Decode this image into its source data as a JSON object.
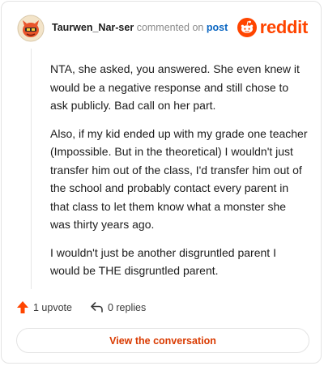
{
  "header": {
    "username": "Taurwen_Nar-ser",
    "commented_on": "commented on",
    "post_link": "post",
    "brand": "reddit"
  },
  "comment": {
    "paragraphs": [
      "NTA, she asked, you answered. She even knew it would be a negative response and still chose to ask publicly. Bad call on her part.",
      "Also, if my kid ended up with my grade one teacher (Impossible. But in the theoretical) I wouldn't just transfer him out of the class, I'd transfer him out of the school and probably contact every parent in that class to let them know what a monster she was thirty years ago.",
      "I wouldn't just be another disgruntled parent I would be THE disgruntled parent."
    ]
  },
  "actions": {
    "upvotes": "1 upvote",
    "replies": "0 replies"
  },
  "footer": {
    "view_conversation": "View the conversation"
  },
  "colors": {
    "brand": "#ff4500",
    "link": "#0a66c2",
    "cta": "#d93a00"
  },
  "icons": [
    "avatar-icon",
    "reddit-snoo-icon",
    "upvote-arrow-icon",
    "reply-arrow-icon"
  ]
}
